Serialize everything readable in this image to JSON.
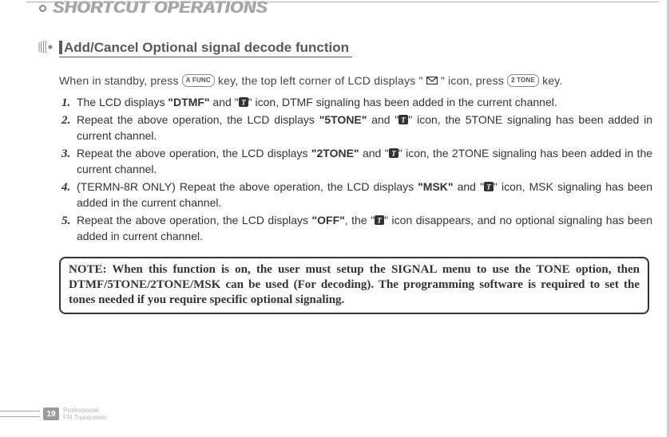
{
  "header": {
    "title": "SHORTCUT OPERATIONS"
  },
  "section": {
    "title": "Add/Cancel Optional signal decode function",
    "intro_part1": "When in standby, press ",
    "key1": "A FUNC",
    "intro_part2": " key, the top left corner of LCD displays \" ",
    "intro_part3": " \"  icon, press ",
    "key2": "2 TONE",
    "intro_part4": " key."
  },
  "steps": [
    {
      "pre": "The LCD displays ",
      "bold1": "\"DTMF\"",
      "mid": " and \"",
      "post": "\" icon, DTMF signaling has been added in the current channel."
    },
    {
      "pre": " Repeat the above operation, the LCD displays ",
      "bold1": "\"5TONE\"",
      "mid": " and \"",
      "post": "\" icon, the 5TONE signaling has been added in current channel."
    },
    {
      "pre": " Repeat the above operation, the LCD displays ",
      "bold1": "\"2TONE\"",
      "mid": " and \"",
      "post": "\" icon, the 2TONE signaling has been added in the current channel."
    },
    {
      "pre": " (TERMN-8R ONLY) Repeat the above operation, the LCD displays ",
      "bold1": "\"MSK\"",
      "mid": " and \"",
      "post": "\" icon, MSK signaling has been added in the current channel."
    },
    {
      "pre": "Repeat the above operation, the LCD displays ",
      "bold1": "\"OFF\"",
      "mid": ", the \"",
      "post": "\" icon disappears, and no optional signaling has been added in current channel."
    }
  ],
  "note": "NOTE: When this function is on, the user must setup the SIGNAL menu to use the TONE option, then DTMF/5TONE/2TONE/MSK can be used (For decoding). The programming software is required to set the tones needed if you require specific optional signaling.",
  "footer": {
    "page": "19",
    "line1": "Professional",
    "line2": "FM Transceiver"
  }
}
